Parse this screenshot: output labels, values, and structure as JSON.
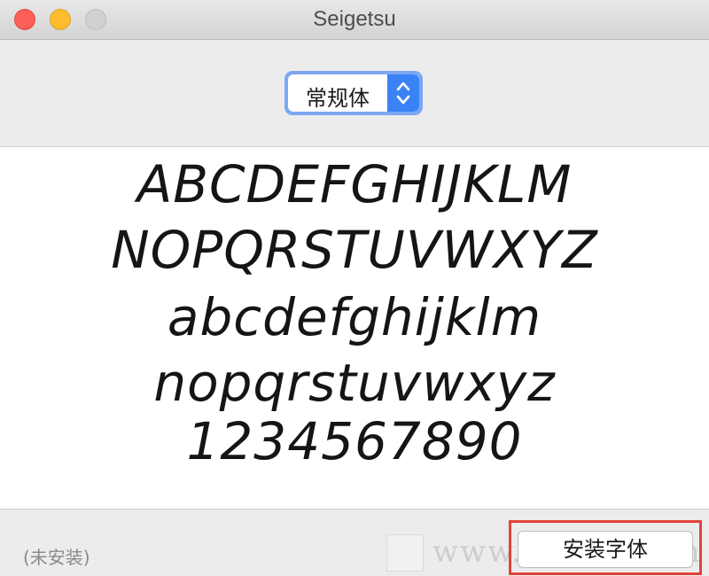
{
  "window": {
    "title": "Seigetsu",
    "controls": {
      "close": "close-icon",
      "minimize": "minimize-icon",
      "zoom": "zoom-icon"
    }
  },
  "style_selector": {
    "selected": "常规体",
    "icon": "chevron-up-down-icon"
  },
  "preview": {
    "lines": [
      "ABCDEFGHIJKLM",
      "NOPQRSTUVWXYZ",
      "abcdefghijklm",
      "nopqrstuvwxyz",
      "1234567890"
    ]
  },
  "footer": {
    "status": "(未安装)",
    "install_label": "安装字体",
    "watermark_text": "www.MacW.com"
  },
  "colors": {
    "close": "#fc5f57",
    "minimize": "#fdbc2e",
    "accent": "#3b82f6",
    "highlight": "#e0443b"
  }
}
